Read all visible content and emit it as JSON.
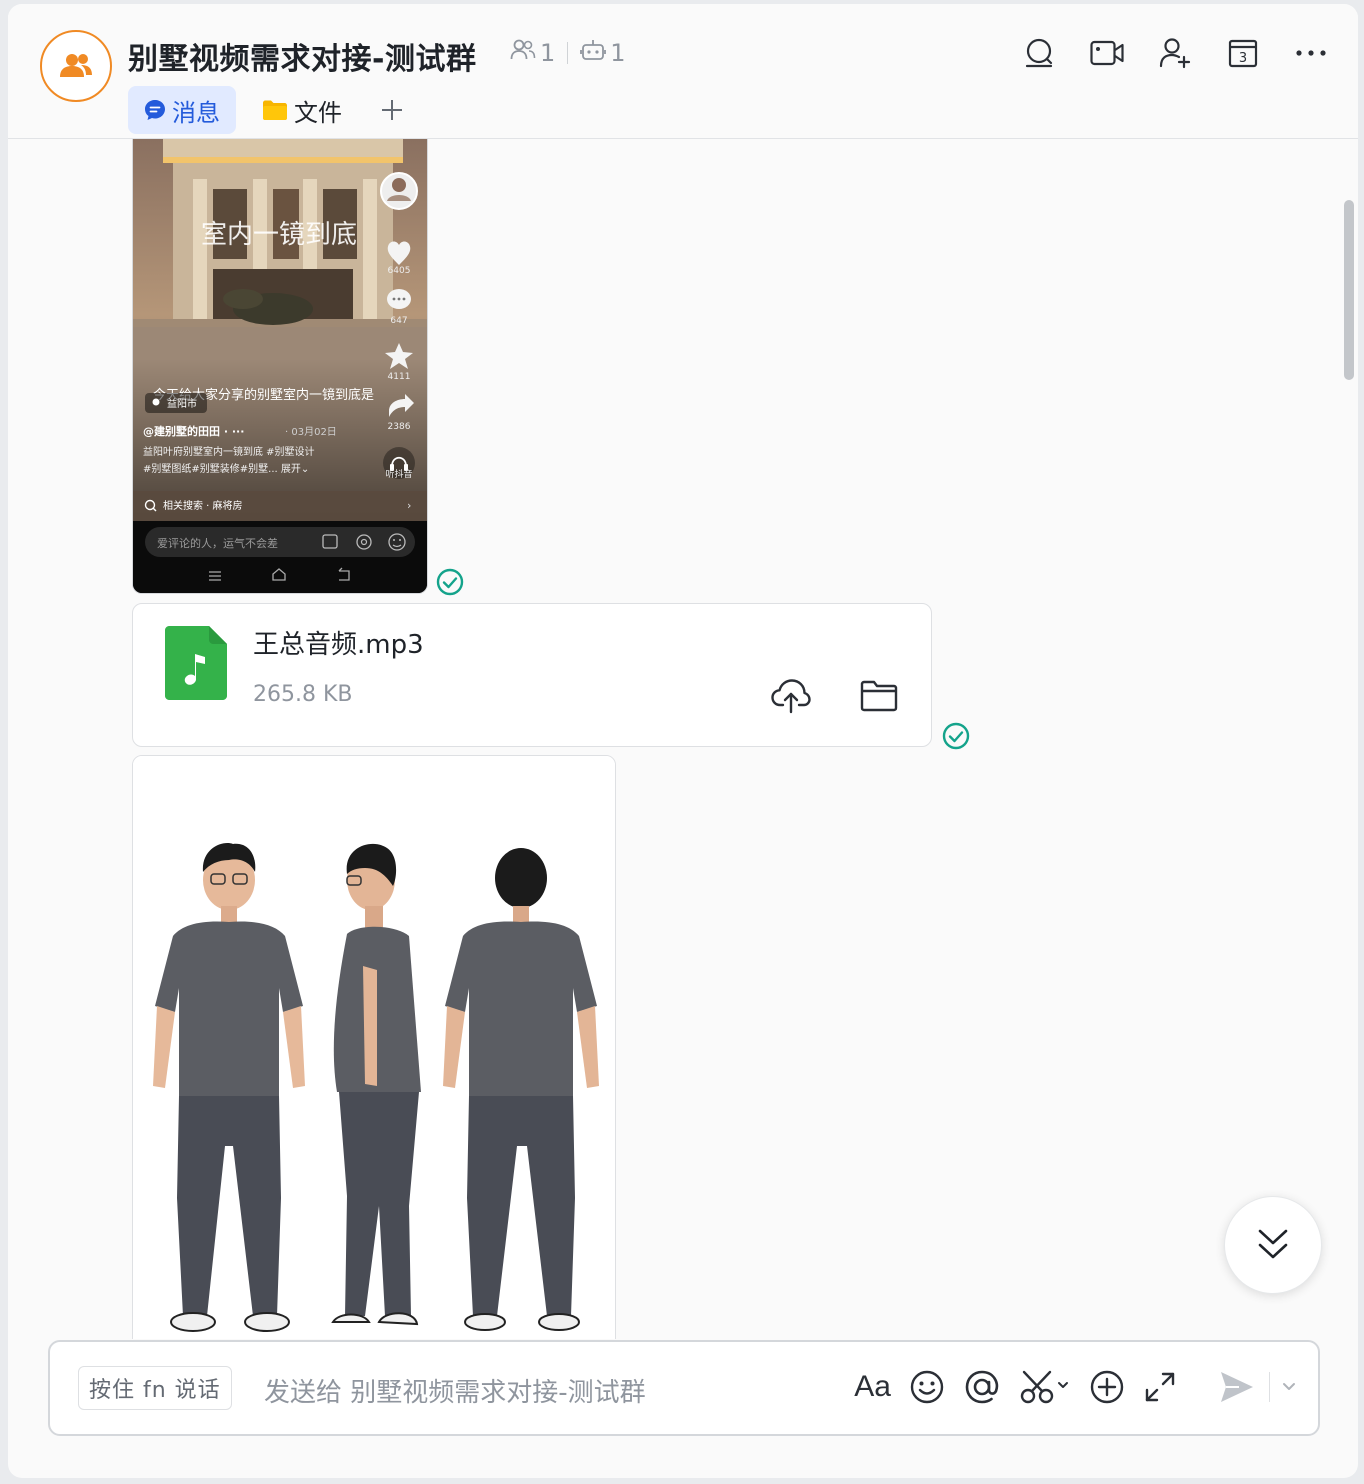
{
  "header": {
    "title": "别墅视频需求对接-测试群",
    "member_count": "1",
    "bot_count": "1",
    "calendar_day": "3"
  },
  "tabs": [
    {
      "label": "消息",
      "active": true
    },
    {
      "label": "文件",
      "active": false
    }
  ],
  "messages": {
    "video_screenshot": {
      "overlay_title": "室内一镜到底",
      "likes": "6405",
      "comments": "647",
      "favorites": "4111",
      "shares": "2386",
      "location": "益阳市",
      "subtitle": "今天给大家分享的别墅室内一镜到底是",
      "author": "@建别墅的田田 · ···",
      "date": "· 03月02日",
      "desc_line1": "益阳叶府别墅室内一镜到底 #别墅设计",
      "desc_line2": "#别墅图纸#别墅装修#别墅... 展开⌄",
      "listen_label": "听抖音",
      "related_search": "相关搜索 · 麻将房",
      "comment_placeholder": "爱评论的人，运气不会差",
      "status": "sent-read"
    },
    "file": {
      "name": "王总音频.mp3",
      "size": "265.8 KB",
      "status": "sent-read"
    },
    "photo": {
      "description_icon": "person-three-views"
    }
  },
  "composer": {
    "hold_to_talk": "按住 fn 说话",
    "placeholder": "发送给 别墅视频需求对接-测试群",
    "font_label": "Aa"
  },
  "colors": {
    "accent": "#245bdb",
    "avatar_ring": "#f08a24",
    "read_check": "#14a38b",
    "file_green": "#34b24a"
  }
}
